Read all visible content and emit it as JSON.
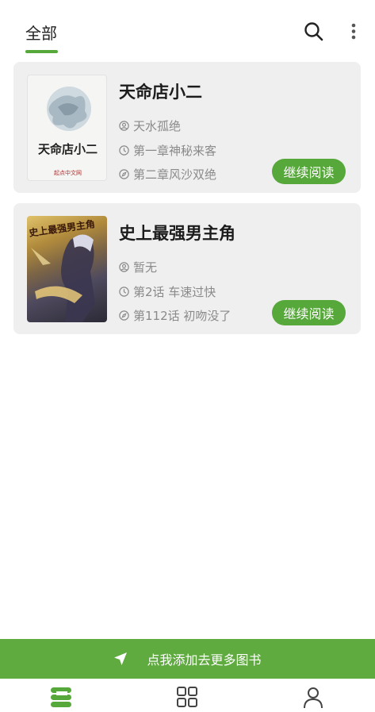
{
  "header": {
    "tab_all": "全部",
    "search_icon": "search-icon",
    "more_icon": "more-vertical-icon",
    "accent_color": "#57a83a"
  },
  "books": [
    {
      "title": "天命店小二",
      "author": "天水孤绝",
      "last_chapter": "第一章神秘来客",
      "current_chapter": "第二章风沙双绝",
      "continue_label": "继续阅读",
      "cover_title": "天命店小二",
      "cover_publisher": "起点中文网"
    },
    {
      "title": "史上最强男主角",
      "author": "暂无",
      "last_chapter": "第2话 车速过快",
      "current_chapter": "第112话 初吻没了",
      "continue_label": "继续阅读",
      "cover_title": "史上最强男主角"
    }
  ],
  "add_banner": {
    "label": "点我添加去更多图书",
    "icon": "navigation-arrow-icon",
    "color": "#5fab3f"
  },
  "bottom_nav": {
    "items": [
      {
        "icon": "bookshelf-icon",
        "active": true
      },
      {
        "icon": "grid-icon",
        "active": false
      },
      {
        "icon": "profile-icon",
        "active": false
      }
    ]
  }
}
